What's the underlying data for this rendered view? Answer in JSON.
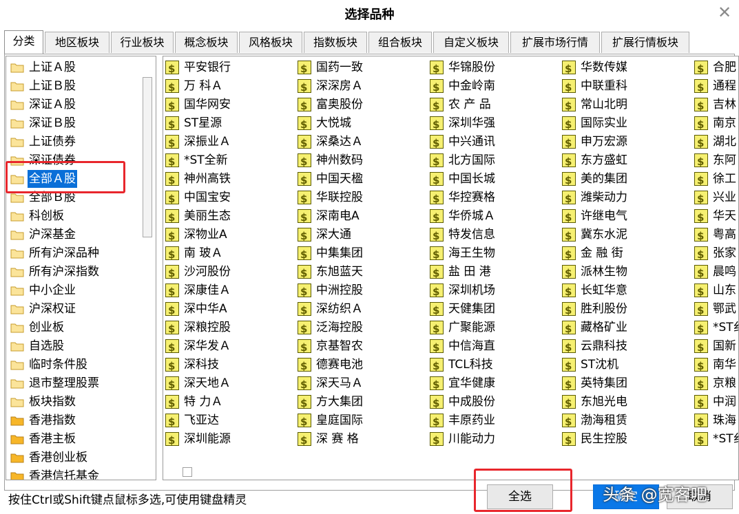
{
  "window": {
    "title": "选择品种",
    "close_symbol": "✕"
  },
  "tabs": [
    "分类",
    "地区板块",
    "行业板块",
    "概念板块",
    "风格板块",
    "指数板块",
    "组合板块",
    "自定义板块",
    "扩展市场行情",
    "扩展行情板块"
  ],
  "active_tab": "分类",
  "tree": {
    "selected": "全部Ａ股",
    "items": [
      "上证Ａ股",
      "上证Ｂ股",
      "深证Ａ股",
      "深证Ｂ股",
      "上证债券",
      "深证债券",
      "全部Ａ股",
      "全部Ｂ股",
      "科创板",
      "沪深基金",
      "所有沪深品种",
      "所有沪深指数",
      "中小企业",
      "沪深权证",
      "创业板",
      "自选股",
      "临时条件股",
      "退市整理股票",
      "板块指数",
      "香港指数",
      "香港主板",
      "香港创业板",
      "香港信托基金"
    ]
  },
  "stock_icon": {
    "name": "dollar-icon",
    "glyph": "$",
    "color": "#f6f071"
  },
  "stock_columns": [
    [
      "平安银行",
      "万 科Ａ",
      "国华网安",
      "ST星源",
      "深振业Ａ",
      "*ST全新",
      "神州高铁",
      "中国宝安",
      "美丽生态",
      "深物业A",
      "南 玻Ａ",
      "沙河股份",
      "深康佳Ａ",
      "深中华A",
      "深粮控股",
      "深华发Ａ",
      "深科技",
      "深天地Ａ",
      "特 力Ａ",
      "飞亚达",
      "深圳能源"
    ],
    [
      "国药一致",
      "深深房Ａ",
      "富奥股份",
      "大悦城",
      "深桑达Ａ",
      "神州数码",
      "中国天楹",
      "华联控股",
      "深南电A",
      "深大通",
      "中集集团",
      "东旭蓝天",
      "中洲控股",
      "深纺织Ａ",
      "泛海控股",
      "京基智农",
      "德赛电池",
      "深天马Ａ",
      "方大集团",
      "皇庭国际",
      "深 赛 格"
    ],
    [
      "华锦股份",
      "中金岭南",
      "农 产 品",
      "深圳华强",
      "中兴通讯",
      "北方国际",
      "中国长城",
      "华控赛格",
      "华侨城Ａ",
      "特发信息",
      "海王生物",
      "盐 田 港",
      "深圳机场",
      "天健集团",
      "广聚能源",
      "中信海直",
      "TCL科技",
      "宜华健康",
      "中成股份",
      "丰原药业",
      "川能动力"
    ],
    [
      "华数传媒",
      "中联重科",
      "常山北明",
      "国际实业",
      "申万宏源",
      "东方盛虹",
      "美的集团",
      "潍柴动力",
      "许继电气",
      "冀东水泥",
      "金 融 街",
      "派林生物",
      "长虹华意",
      "胜利股份",
      "藏格矿业",
      "云鼎科技",
      "ST沈机",
      "英特集团",
      "东旭光电",
      "渤海租赁",
      "民生控股"
    ],
    [
      "合肥",
      "通程",
      "吉林",
      "南京",
      "湖北",
      "东阿",
      "徐工",
      "兴业",
      "华天",
      "粤高",
      "张家",
      "晨鸣",
      "山东",
      "鄂武",
      "*ST纟",
      "国新",
      "南华",
      "京粮",
      "中润",
      "珠海",
      "*ST纟"
    ]
  ],
  "hint": "按住Ctrl或Shift键点鼠标多选,可使用键盘精灵",
  "buttons": {
    "select_all": "全选",
    "confirm": "确定",
    "cancel": "取消"
  },
  "watermark": "头条 @宽客吧",
  "highlight_color": "#e8262c"
}
